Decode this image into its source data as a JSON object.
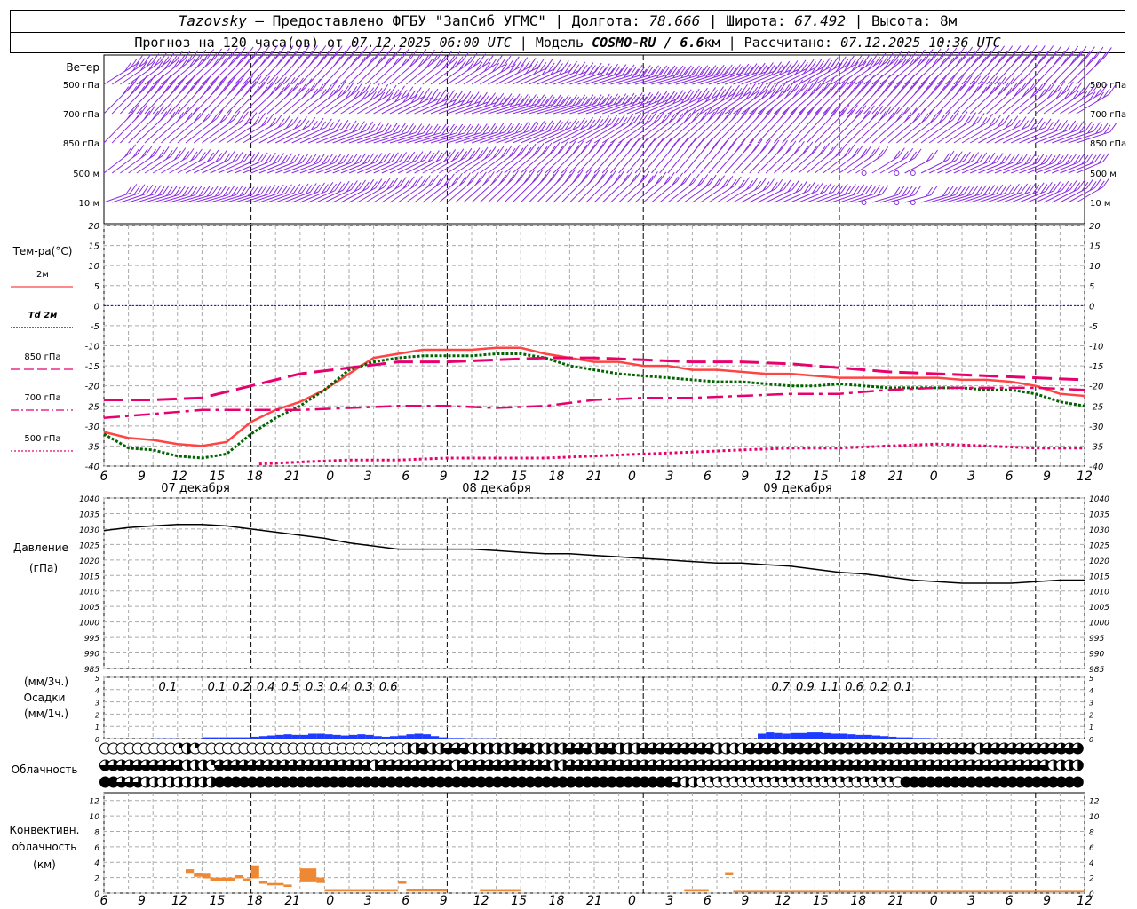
{
  "header": {
    "station": "Tazovsky",
    "provider": " — Предоставлено ФГБУ \"ЗапСиб УГМС\" | Долгота: ",
    "lon": "78.666",
    "lat_label": " | Широта: ",
    "lat": "67.492",
    "alt_label": " | Высота: 8м",
    "forecast_label": "Прогноз на 120 часа(ов) от ",
    "forecast_time": "07.12.2025 06:00 UTC",
    "model_label": " | Модель ",
    "model": "COSMO-RU / 6.6",
    "model_unit": "км",
    "calc_label": " | Рассчитано: ",
    "calc_time": "07.12.2025 10:36 UTC"
  },
  "colors": {
    "t2m": "#ff4444",
    "td2m": "#006400",
    "t850": "#e8006e",
    "t700": "#e8006e",
    "t500": "#e8006e",
    "wind": "#8a2be2",
    "pressure": "#000000",
    "precip": "#1e3cff",
    "convective": "#ee8833",
    "zero_line": "#0000ff"
  },
  "chart_data": {
    "type": "line",
    "x_hours": [
      6,
      9,
      12,
      15,
      18,
      21,
      0,
      3,
      6,
      9,
      12,
      15,
      18,
      21,
      0,
      3,
      6,
      9,
      12,
      15,
      18,
      21,
      0,
      3,
      6,
      9,
      12
    ],
    "day_labels": [
      "07 декабря",
      "08 декабря",
      "09 декабря"
    ],
    "wind": {
      "level_labels": [
        "Ветер",
        "500 гПа",
        "700 гПа",
        "850 гПа",
        "500 м",
        "10  м"
      ],
      "right_labels": [
        "500 гПа",
        "700 гПа",
        "850 гПа",
        "500 м",
        "10  м"
      ]
    },
    "temperature": {
      "title": "Тем-ра(°C)",
      "ylim": [
        -40,
        20
      ],
      "yticks": [
        20,
        15,
        10,
        5,
        0,
        -5,
        -10,
        -15,
        -20,
        -25,
        -30,
        -35,
        -40
      ],
      "legend": [
        "2м",
        "Td  2м",
        "850 гПа",
        "700 гПа",
        "500 гПа"
      ],
      "series": [
        {
          "name": "2м",
          "x": [
            0,
            3,
            6,
            9,
            12,
            15,
            18,
            21,
            24,
            27,
            30,
            33,
            36,
            39,
            42,
            45,
            48,
            51,
            54,
            57,
            60,
            63,
            66,
            69,
            72,
            75,
            78,
            81,
            84,
            87,
            90,
            93,
            96,
            99,
            102,
            105,
            108,
            111,
            114,
            117,
            120
          ],
          "values": [
            -31.5,
            -33,
            -33.5,
            -34.5,
            -35,
            -34,
            -29,
            -26,
            -24,
            -21,
            -17,
            -13,
            -12,
            -11,
            -11,
            -11,
            -10.5,
            -10.5,
            -12,
            -13,
            -14,
            -14,
            -15,
            -15,
            -16,
            -16,
            -16.5,
            -17,
            -17,
            -17.5,
            -18,
            -18,
            -18,
            -18,
            -18,
            -18.5,
            -18.5,
            -19,
            -20,
            -22,
            -22.5
          ]
        },
        {
          "name": "Td  2м",
          "x": [
            0,
            3,
            6,
            9,
            12,
            15,
            18,
            21,
            24,
            27,
            30,
            33,
            36,
            39,
            42,
            45,
            48,
            51,
            54,
            57,
            60,
            63,
            66,
            69,
            72,
            75,
            78,
            81,
            84,
            87,
            90,
            93,
            96,
            99,
            102,
            105,
            108,
            111,
            114,
            117,
            120
          ],
          "values": [
            -32,
            -35.5,
            -36,
            -37.5,
            -38,
            -37,
            -32,
            -28,
            -25,
            -21,
            -16,
            -14,
            -13,
            -12.5,
            -12.5,
            -12.5,
            -12,
            -12,
            -13,
            -15,
            -16,
            -17,
            -17.5,
            -18,
            -18.5,
            -19,
            -19,
            -19.5,
            -20,
            -20,
            -19.5,
            -20,
            -20.5,
            -20.5,
            -20.5,
            -20.5,
            -21,
            -21,
            -22,
            -24,
            -25
          ]
        },
        {
          "name": "850 гПа",
          "x": [
            0,
            6,
            12,
            18,
            24,
            30,
            36,
            42,
            48,
            54,
            60,
            66,
            72,
            78,
            84,
            90,
            96,
            102,
            108,
            114,
            120
          ],
          "values": [
            -23.5,
            -23.5,
            -23,
            -20,
            -17,
            -15.5,
            -14,
            -14,
            -13.5,
            -13,
            -13,
            -13.5,
            -14,
            -14,
            -14.5,
            -15.5,
            -16.5,
            -17,
            -17.5,
            -18,
            -18.5
          ]
        },
        {
          "name": "700 гПа",
          "x": [
            0,
            6,
            12,
            18,
            24,
            30,
            36,
            42,
            48,
            54,
            60,
            66,
            72,
            78,
            84,
            90,
            96,
            102,
            108,
            114,
            120
          ],
          "values": [
            -28,
            -27,
            -26,
            -26,
            -26,
            -25.5,
            -25,
            -25,
            -25.5,
            -25,
            -23.5,
            -23,
            -23,
            -22.5,
            -22,
            -22,
            -21,
            -20.5,
            -20.5,
            -20.5,
            -21
          ]
        },
        {
          "name": "500 гПа",
          "x": [
            19,
            24,
            30,
            36,
            42,
            48,
            54,
            60,
            66,
            72,
            78,
            84,
            90,
            96,
            102,
            108,
            114,
            120
          ],
          "values": [
            -39.5,
            -39,
            -38.5,
            -38.5,
            -38,
            -38,
            -38,
            -37.5,
            -37,
            -36.5,
            -36,
            -35.5,
            -35.5,
            -35,
            -34.5,
            -35,
            -35.5,
            -35.5
          ]
        }
      ]
    },
    "pressure": {
      "title": "Давление",
      "unit": "(гПа)",
      "ylim": [
        985,
        1040
      ],
      "yticks": [
        1040,
        1035,
        1030,
        1025,
        1020,
        1015,
        1010,
        1005,
        1000,
        995,
        990,
        985
      ],
      "x": [
        0,
        3,
        6,
        9,
        12,
        15,
        18,
        21,
        24,
        27,
        30,
        33,
        36,
        39,
        42,
        45,
        48,
        51,
        54,
        57,
        60,
        63,
        66,
        69,
        72,
        75,
        78,
        81,
        84,
        87,
        90,
        93,
        96,
        99,
        102,
        105,
        108,
        111,
        114,
        117,
        120
      ],
      "values": [
        1029.5,
        1030.5,
        1031,
        1031.5,
        1031.5,
        1031,
        1030,
        1029,
        1028,
        1027,
        1025.5,
        1024.5,
        1023.5,
        1023.5,
        1023.5,
        1023.5,
        1023,
        1022.5,
        1022,
        1022,
        1021.5,
        1021,
        1020.5,
        1020,
        1019.5,
        1019,
        1019,
        1018.5,
        1018,
        1017,
        1016,
        1015.5,
        1014.5,
        1013.5,
        1013,
        1012.5,
        1012.5,
        1012.5,
        1013,
        1013.5,
        1013.5
      ]
    },
    "precipitation": {
      "title": "Осадки",
      "unit_3h": "(мм/3ч.)",
      "unit_1h": "(мм/1ч.)",
      "ylim": [
        0,
        5
      ],
      "yticks": [
        5,
        4,
        3,
        2,
        1,
        0
      ],
      "labels_3h": [
        {
          "x": 9,
          "text": "0.1"
        },
        {
          "x": 15,
          "text": "0.1"
        },
        {
          "x": 18,
          "text": "0.2"
        },
        {
          "x": 21,
          "text": "0.4"
        },
        {
          "x": 24,
          "text": "0.5"
        },
        {
          "x": 27,
          "text": "0.3"
        },
        {
          "x": 30,
          "text": "0.4"
        },
        {
          "x": 33,
          "text": "0.3"
        },
        {
          "x": 36,
          "text": "0.6"
        },
        {
          "x": 84,
          "text": "0.7"
        },
        {
          "x": 87,
          "text": "0.9"
        },
        {
          "x": 90,
          "text": "1.1"
        },
        {
          "x": 93,
          "text": "0.6"
        },
        {
          "x": 96,
          "text": "0.2"
        },
        {
          "x": 99,
          "text": "0.1"
        }
      ],
      "hourly": [
        0,
        0,
        0,
        0,
        0,
        0,
        0.02,
        0.02,
        0.02,
        0,
        0,
        0,
        0.1,
        0.1,
        0.1,
        0.1,
        0.1,
        0.1,
        0.15,
        0.2,
        0.25,
        0.3,
        0.35,
        0.3,
        0.3,
        0.4,
        0.4,
        0.35,
        0.3,
        0.25,
        0.3,
        0.35,
        0.3,
        0.2,
        0.15,
        0.2,
        0.25,
        0.35,
        0.4,
        0.35,
        0.2,
        0.1,
        0.05,
        0.05,
        0.02,
        0.02,
        0.02,
        0.02,
        0,
        0,
        0,
        0,
        0,
        0,
        0,
        0,
        0,
        0,
        0,
        0,
        0,
        0,
        0,
        0,
        0,
        0,
        0,
        0,
        0,
        0,
        0,
        0,
        0,
        0,
        0,
        0,
        0,
        0,
        0,
        0,
        0.4,
        0.5,
        0.45,
        0.4,
        0.45,
        0.45,
        0.5,
        0.5,
        0.45,
        0.4,
        0.4,
        0.35,
        0.3,
        0.3,
        0.25,
        0.2,
        0.15,
        0.1,
        0.1,
        0.05,
        0.05,
        0.02,
        0,
        0,
        0,
        0,
        0,
        0,
        0,
        0,
        0,
        0,
        0,
        0,
        0
      ]
    },
    "cloudiness": {
      "title": "Облачность",
      "rows": [
        [
          0,
          0,
          0,
          0,
          0,
          0,
          0,
          0,
          0,
          1,
          2,
          1,
          0,
          0,
          0,
          0,
          0,
          0,
          0,
          0,
          0,
          0,
          0,
          0,
          0,
          0,
          0,
          0,
          0,
          0,
          0,
          0,
          0,
          0,
          0,
          0,
          0,
          2,
          2,
          3,
          2,
          2,
          3,
          3,
          3,
          2,
          2,
          2,
          2,
          2,
          2,
          3,
          3,
          2,
          2,
          2,
          2,
          3,
          3,
          3,
          2,
          3,
          3,
          2,
          2,
          2,
          3,
          3,
          3,
          3,
          3,
          3,
          3,
          3,
          3,
          2,
          2,
          2,
          2,
          3,
          3,
          3,
          3,
          2,
          3,
          3,
          3,
          3,
          2,
          3,
          3,
          3,
          3,
          3,
          3,
          3,
          3,
          3,
          3,
          3,
          3,
          3,
          3,
          3,
          3,
          3,
          3,
          2,
          3,
          3,
          3,
          3,
          3,
          3,
          3,
          3,
          3,
          3,
          3,
          3
        ],
        [
          3,
          3,
          3,
          3,
          3,
          3,
          3,
          3,
          3,
          3,
          2,
          2,
          2,
          1,
          3,
          3,
          3,
          3,
          3,
          3,
          3,
          3,
          3,
          3,
          3,
          3,
          3,
          3,
          3,
          3,
          3,
          3,
          3,
          2,
          3,
          3,
          3,
          3,
          3,
          3,
          3,
          3,
          3,
          2,
          3,
          3,
          3,
          3,
          3,
          3,
          3,
          3,
          3,
          3,
          3,
          2,
          2,
          3,
          3,
          3,
          3,
          3,
          3,
          3,
          3,
          3,
          3,
          3,
          3,
          3,
          3,
          3,
          3,
          3,
          3,
          3,
          3,
          3,
          3,
          3,
          3,
          3,
          3,
          3,
          3,
          3,
          3,
          3,
          3,
          3,
          3,
          3,
          3,
          3,
          3,
          3,
          3,
          3,
          3,
          3,
          3,
          3,
          3,
          3,
          3,
          3,
          3,
          3,
          3,
          3,
          3,
          3,
          3,
          3,
          3,
          3,
          2,
          2,
          2,
          2,
          3
        ],
        [
          4,
          4,
          3,
          3,
          3,
          2,
          2,
          2,
          2,
          2,
          2,
          2,
          2,
          2,
          4,
          4,
          4,
          4,
          4,
          4,
          4,
          4,
          4,
          4,
          4,
          4,
          4,
          4,
          4,
          4,
          4,
          4,
          4,
          4,
          4,
          4,
          4,
          4,
          4,
          4,
          4,
          4,
          4,
          4,
          4,
          4,
          4,
          4,
          4,
          4,
          4,
          4,
          4,
          4,
          4,
          4,
          4,
          4,
          4,
          4,
          4,
          4,
          4,
          4,
          4,
          4,
          4,
          4,
          4,
          4,
          3,
          2,
          2,
          1,
          1,
          1,
          1,
          1,
          1,
          1,
          1,
          1,
          1,
          1,
          1,
          1,
          1,
          1,
          1,
          1,
          1,
          1,
          1,
          1,
          1,
          1,
          1,
          0,
          4,
          4,
          4,
          4,
          4,
          4,
          4,
          4,
          4,
          4,
          4,
          4,
          4,
          4,
          4,
          4,
          4,
          4,
          4,
          4,
          4,
          4,
          4
        ]
      ]
    },
    "convective": {
      "title_1": "Конвективн.",
      "title_2": "облачность",
      "unit": "(км)",
      "ylim": [
        0,
        13
      ],
      "yticks": [
        12,
        10,
        8,
        6,
        4,
        2,
        0
      ],
      "blocks": [
        {
          "x0": 10,
          "x1": 11,
          "bottom": 2.5,
          "top": 3.1
        },
        {
          "x0": 11,
          "x1": 12,
          "bottom": 2.1,
          "top": 2.6
        },
        {
          "x0": 12,
          "x1": 13,
          "bottom": 1.9,
          "top": 2.5
        },
        {
          "x0": 13,
          "x1": 16,
          "bottom": 1.6,
          "top": 2.0
        },
        {
          "x0": 16,
          "x1": 17,
          "bottom": 1.9,
          "top": 2.3
        },
        {
          "x0": 17,
          "x1": 18,
          "bottom": 1.5,
          "top": 1.9
        },
        {
          "x0": 18,
          "x1": 19,
          "bottom": 1.9,
          "top": 3.6
        },
        {
          "x0": 19,
          "x1": 20,
          "bottom": 1.2,
          "top": 1.5
        },
        {
          "x0": 20,
          "x1": 22,
          "bottom": 1.0,
          "top": 1.3
        },
        {
          "x0": 22,
          "x1": 23,
          "bottom": 0.8,
          "top": 1.1
        },
        {
          "x0": 24,
          "x1": 26,
          "bottom": 1.4,
          "top": 3.2
        },
        {
          "x0": 26,
          "x1": 27,
          "bottom": 1.3,
          "top": 2.0
        },
        {
          "x0": 27,
          "x1": 36,
          "bottom": 0.2,
          "top": 0.4
        },
        {
          "x0": 36,
          "x1": 37,
          "bottom": 1.2,
          "top": 1.5
        },
        {
          "x0": 37,
          "x1": 42,
          "bottom": 0.2,
          "top": 0.5
        },
        {
          "x0": 46,
          "x1": 51,
          "bottom": 0.2,
          "top": 0.4
        },
        {
          "x0": 71,
          "x1": 74,
          "bottom": 0.2,
          "top": 0.4
        },
        {
          "x0": 76,
          "x1": 77,
          "bottom": 2.3,
          "top": 2.7
        },
        {
          "x0": 77,
          "x1": 120,
          "bottom": 0.1,
          "top": 0.3
        }
      ]
    }
  }
}
